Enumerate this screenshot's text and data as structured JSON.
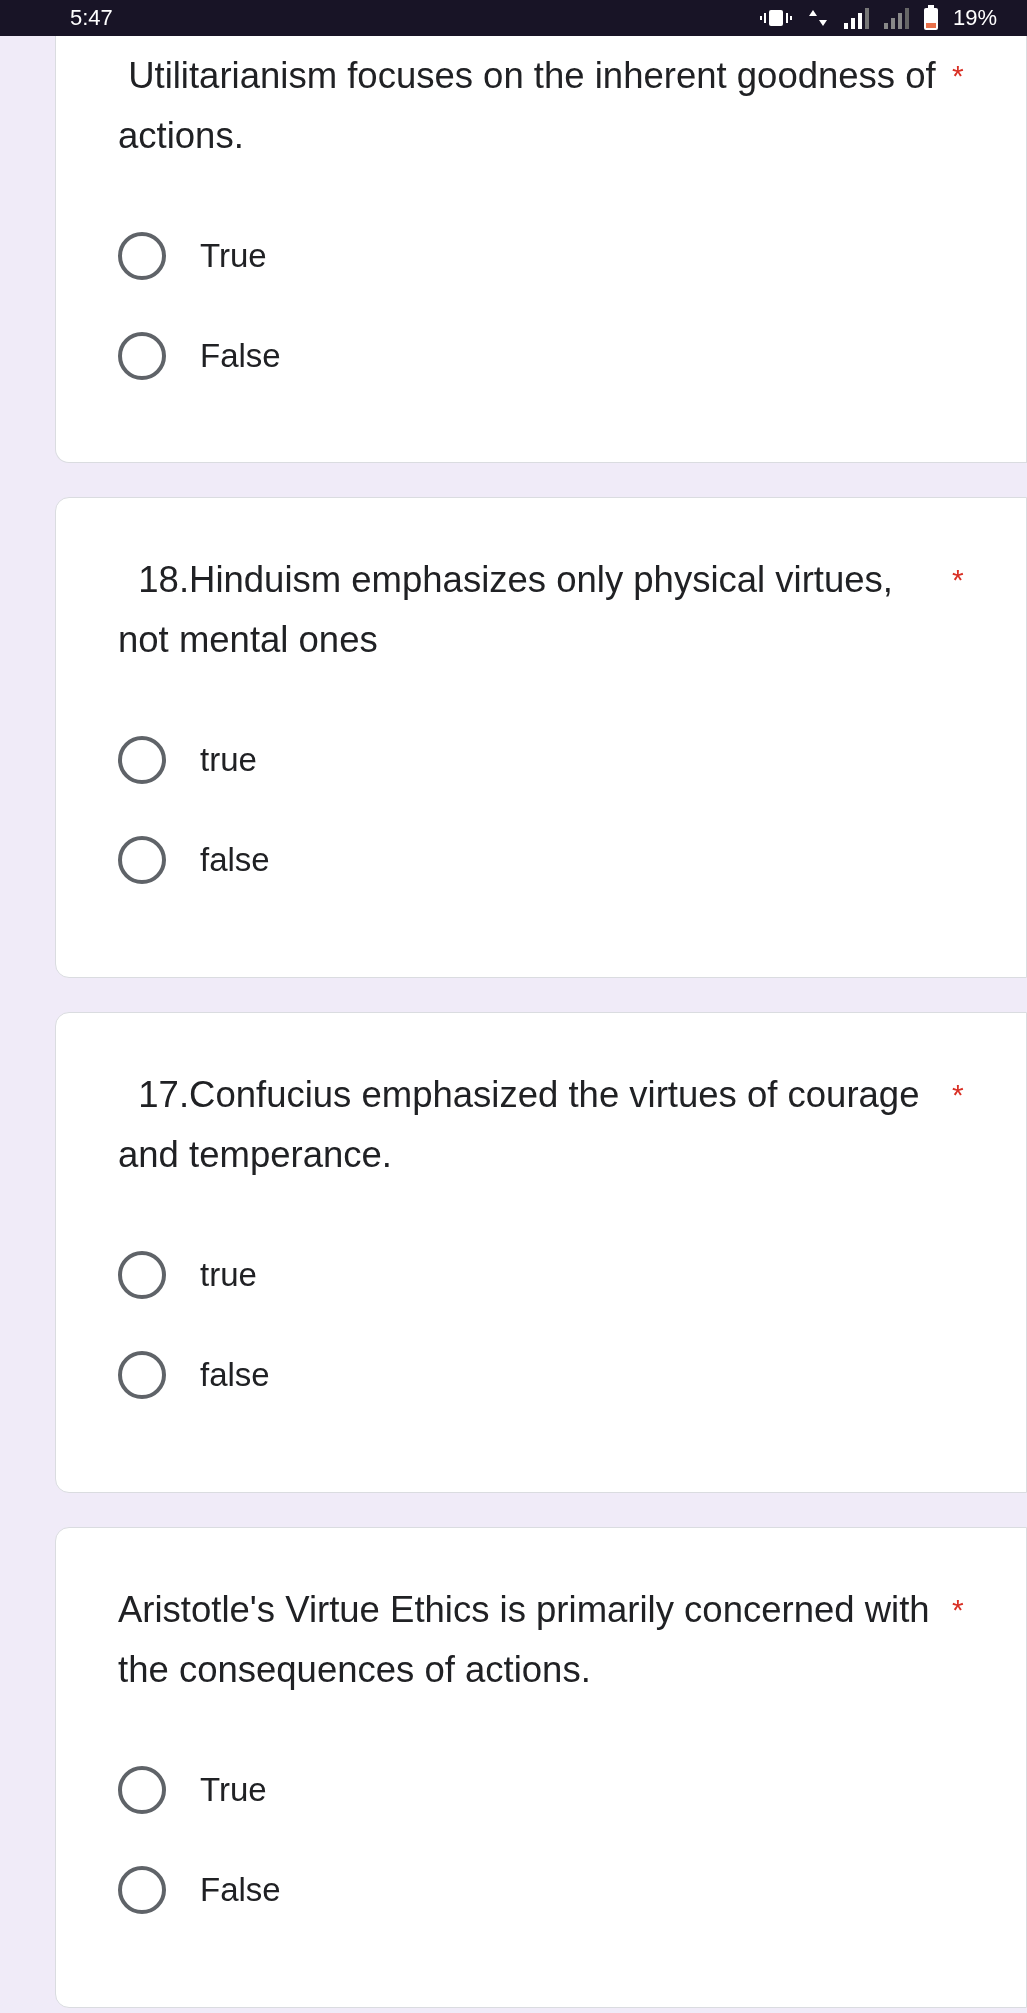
{
  "status_bar": {
    "time": "5:47",
    "battery": "19%"
  },
  "questions": [
    {
      "text": " Utilitarianism focuses on the inherent goodness of actions.",
      "required": "*",
      "options": [
        {
          "label": "True",
          "selected": false
        },
        {
          "label": "False",
          "selected": false
        }
      ]
    },
    {
      "text": "  18.Hinduism emphasizes only physical virtues, not mental ones",
      "required": "*",
      "options": [
        {
          "label": "true",
          "selected": false
        },
        {
          "label": "false",
          "selected": false
        }
      ]
    },
    {
      "text": "  17.Confucius emphasized the virtues of courage and temperance.",
      "required": "*",
      "options": [
        {
          "label": "true",
          "selected": false
        },
        {
          "label": "false",
          "selected": false
        }
      ]
    },
    {
      "text": "Aristotle's Virtue Ethics is primarily concerned with the consequences of actions.",
      "required": "*",
      "options": [
        {
          "label": "True",
          "selected": false
        },
        {
          "label": "False",
          "selected": false
        }
      ]
    }
  ]
}
